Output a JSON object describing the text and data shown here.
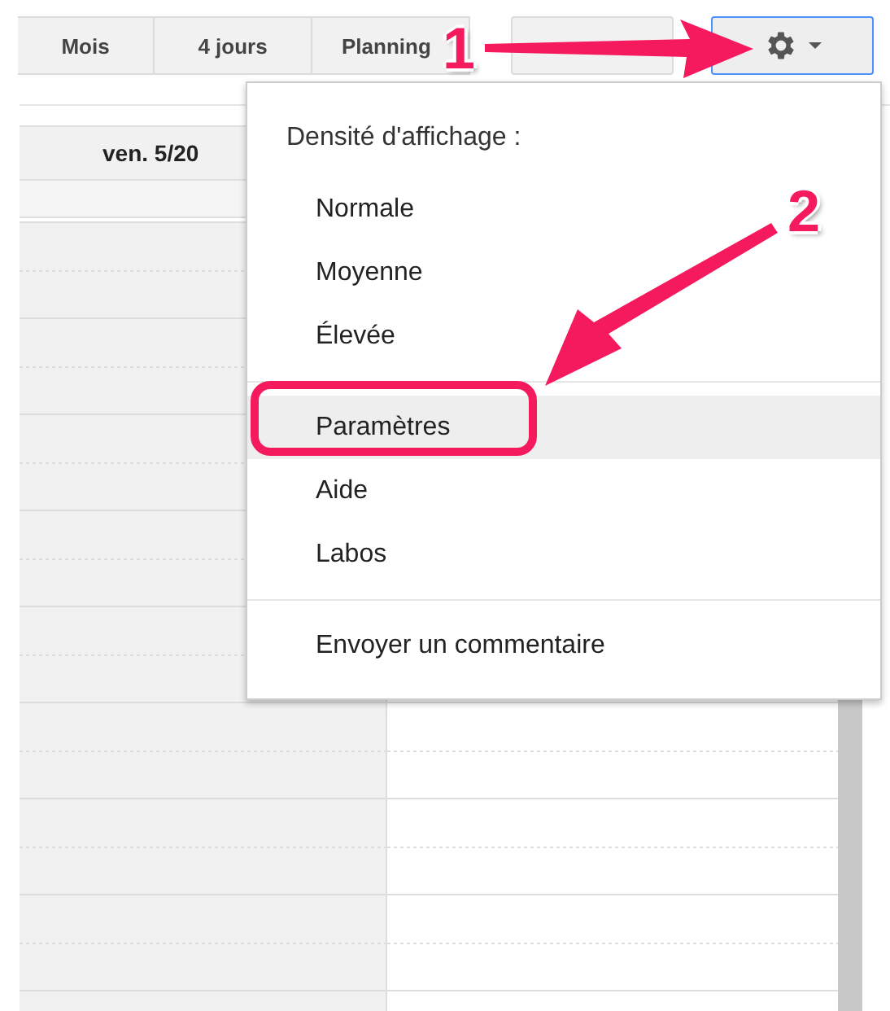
{
  "toolbar": {
    "buttons": [
      {
        "label": "Mois"
      },
      {
        "label": "4 jours"
      },
      {
        "label": "Planning"
      }
    ],
    "settings_button": {
      "open": true
    }
  },
  "calendar": {
    "day_header": "ven. 5/20"
  },
  "menu": {
    "heading": "Densité d'affichage :",
    "sections": [
      [
        {
          "label": "Normale",
          "highlighted": false
        },
        {
          "label": "Moyenne",
          "highlighted": false
        },
        {
          "label": "Élevée",
          "highlighted": false
        }
      ],
      [
        {
          "label": "Paramètres",
          "highlighted": true
        },
        {
          "label": "Aide",
          "highlighted": false
        },
        {
          "label": "Labos",
          "highlighted": false
        }
      ],
      [
        {
          "label": "Envoyer un commentaire",
          "highlighted": false
        }
      ]
    ]
  },
  "annotations": [
    {
      "label": "1"
    },
    {
      "label": "2"
    }
  ]
}
